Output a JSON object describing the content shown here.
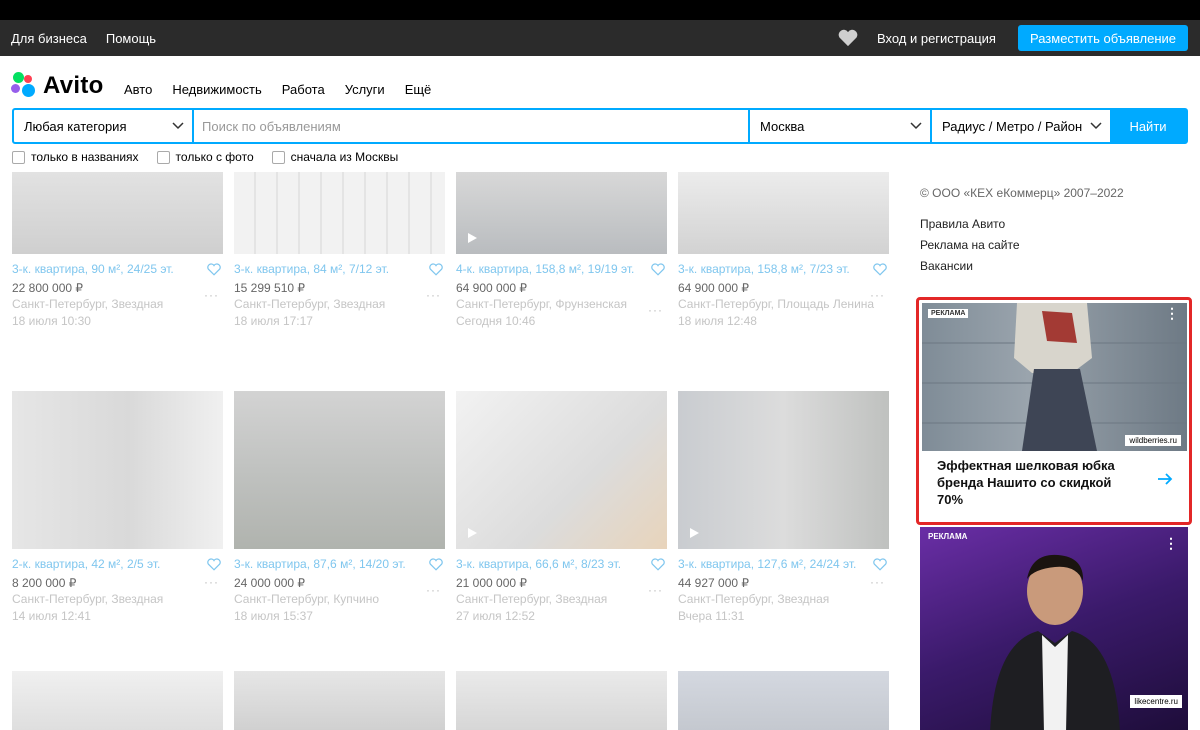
{
  "topbar": {
    "business": "Для бизнеса",
    "help": "Помощь",
    "login": "Вход и регистрация",
    "post_ad": "Разместить объявление"
  },
  "logo": {
    "text": "Avito"
  },
  "nav": [
    "Авто",
    "Недвижимость",
    "Работа",
    "Услуги",
    "Ещё"
  ],
  "search": {
    "category": "Любая категория",
    "placeholder": "Поиск по объявлениям",
    "city": "Москва",
    "radius": "Радиус / Метро / Район",
    "submit": "Найти"
  },
  "filters": [
    "только в названиях",
    "только с фото",
    "сначала из Москвы"
  ],
  "listings": [
    {
      "title": "3-к. квартира, 90 м², 24/25 эт.",
      "price": "22 800 000 ₽",
      "location": "Санкт-Петербург, Звездная",
      "date": "18 июля 10:30"
    },
    {
      "title": "3-к. квартира, 84 м², 7/12 эт.",
      "price": "15 299 510 ₽",
      "location": "Санкт-Петербург, Звездная",
      "date": "18 июля 17:17"
    },
    {
      "title": "4-к. квартира, 158,8 м², 19/19 эт.",
      "price": "64 900 000 ₽",
      "location": "Санкт-Петербург, Фрунзенская",
      "date": "Сегодня 10:46"
    },
    {
      "title": "3-к. квартира, 158,8 м², 7/23 эт.",
      "price": "64 900 000 ₽",
      "location": "Санкт-Петербург, Площадь Ленина",
      "date": "18 июля 12:48"
    },
    {
      "title": "2-к. квартира, 42 м², 2/5 эт.",
      "price": "8 200 000 ₽",
      "location": "Санкт-Петербург, Звездная",
      "date": "14 июля 12:41"
    },
    {
      "title": "3-к. квартира, 87,6 м², 14/20 эт.",
      "price": "24 000 000 ₽",
      "location": "Санкт-Петербург, Купчино",
      "date": "18 июля 15:37"
    },
    {
      "title": "3-к. квартира, 66,6 м², 8/23 эт.",
      "price": "21 000 000 ₽",
      "location": "Санкт-Петербург, Звездная",
      "date": "27 июля 12:52"
    },
    {
      "title": "3-к. квартира, 127,6 м², 24/24 эт.",
      "price": "44 927 000 ₽",
      "location": "Санкт-Петербург, Звездная",
      "date": "Вчера 11:31"
    }
  ],
  "sidebar": {
    "copyright": "© ООО «КЕХ еКоммерц» 2007–2022",
    "links": [
      "Правила Авито",
      "Реклама на сайте",
      "Вакансии"
    ]
  },
  "ads": {
    "label": "РЕКЛАМА",
    "ad1_text": "Эффектная шелковая юбка бренда Нашито со скидкой 70%",
    "ad1_brand": "wildberries.ru",
    "ad2_label": "РЕКЛАМА",
    "ad2_brand": "likecentre.ru"
  },
  "colors": {
    "accent": "#00aaff",
    "highlight": "#e32727",
    "title_link": "#7fc6ee"
  }
}
